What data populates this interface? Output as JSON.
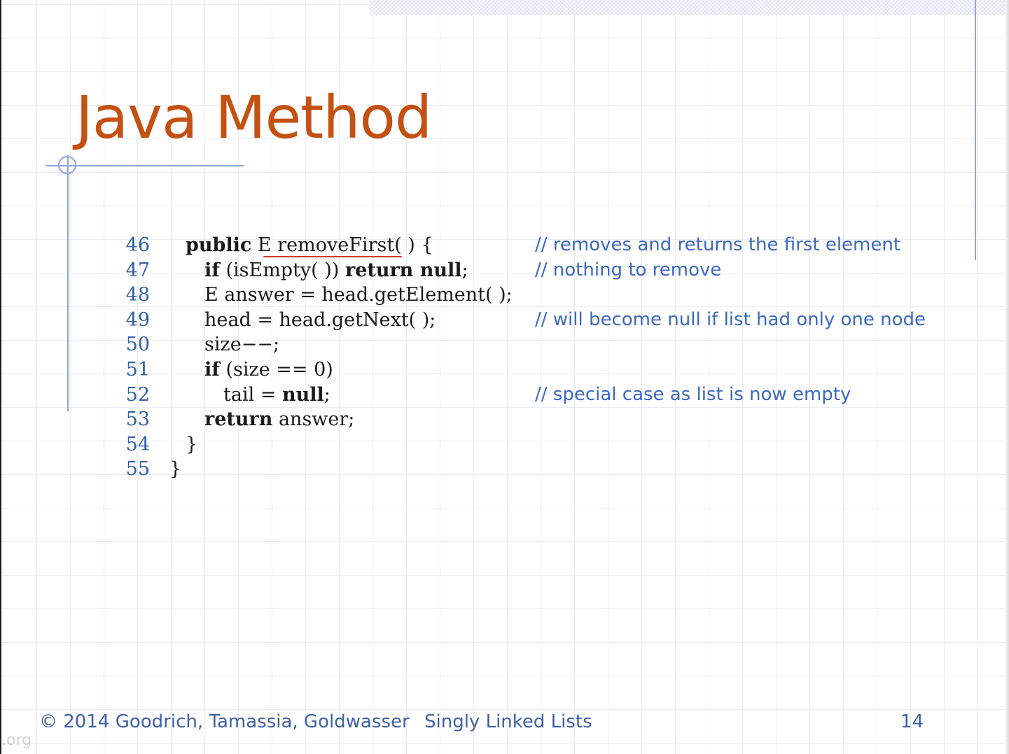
{
  "slide": {
    "title": "Java Method",
    "code_lines": [
      {
        "num": "46",
        "parts": [
          {
            "t": "public",
            "b": true
          },
          {
            "t": " E removeFirst( ) {",
            "b": false
          }
        ],
        "comment": "// removes and returns the first element"
      },
      {
        "num": "47",
        "parts": [
          {
            "t": "if",
            "b": true
          },
          {
            "t": " (isEmpty( )) ",
            "b": false
          },
          {
            "t": "return null",
            "b": true
          },
          {
            "t": ";",
            "b": false
          }
        ],
        "comment": "// nothing to remove"
      },
      {
        "num": "48",
        "parts": [
          {
            "t": "E answer = head.getElement( );",
            "b": false
          }
        ],
        "comment": ""
      },
      {
        "num": "49",
        "parts": [
          {
            "t": "head = head.getNext( );",
            "b": false
          }
        ],
        "comment": "// will become null if list had only one node"
      },
      {
        "num": "50",
        "parts": [
          {
            "t": "size−−;",
            "b": false
          }
        ],
        "comment": ""
      },
      {
        "num": "51",
        "parts": [
          {
            "t": "if",
            "b": true
          },
          {
            "t": " (size == 0)",
            "b": false
          }
        ],
        "comment": ""
      },
      {
        "num": "52",
        "parts": [
          {
            "t": "tail = ",
            "b": false
          },
          {
            "t": "null",
            "b": true
          },
          {
            "t": ";",
            "b": false
          }
        ],
        "comment": "// special case as list is now empty"
      },
      {
        "num": "53",
        "parts": [
          {
            "t": "return",
            "b": true
          },
          {
            "t": " answer;",
            "b": false
          }
        ],
        "comment": ""
      },
      {
        "num": "54",
        "parts": [
          {
            "t": "}",
            "b": false
          }
        ],
        "comment": ""
      },
      {
        "num": "55",
        "parts": [
          {
            "t": "}",
            "b": false
          }
        ],
        "comment": ""
      }
    ]
  },
  "footer": {
    "copyright": "© 2014 Goodrich, Tamassia, Goldwasser",
    "topic": "Singly Linked Lists",
    "page_number": "14"
  },
  "watermark": ".org",
  "colors": {
    "title": "#c45011",
    "line_numbers": "#2f5fa8",
    "comments": "#3b68c2",
    "footer": "#3f60a6",
    "decoration": "#8fa6d8",
    "spell_underline": "#d33a2a"
  }
}
